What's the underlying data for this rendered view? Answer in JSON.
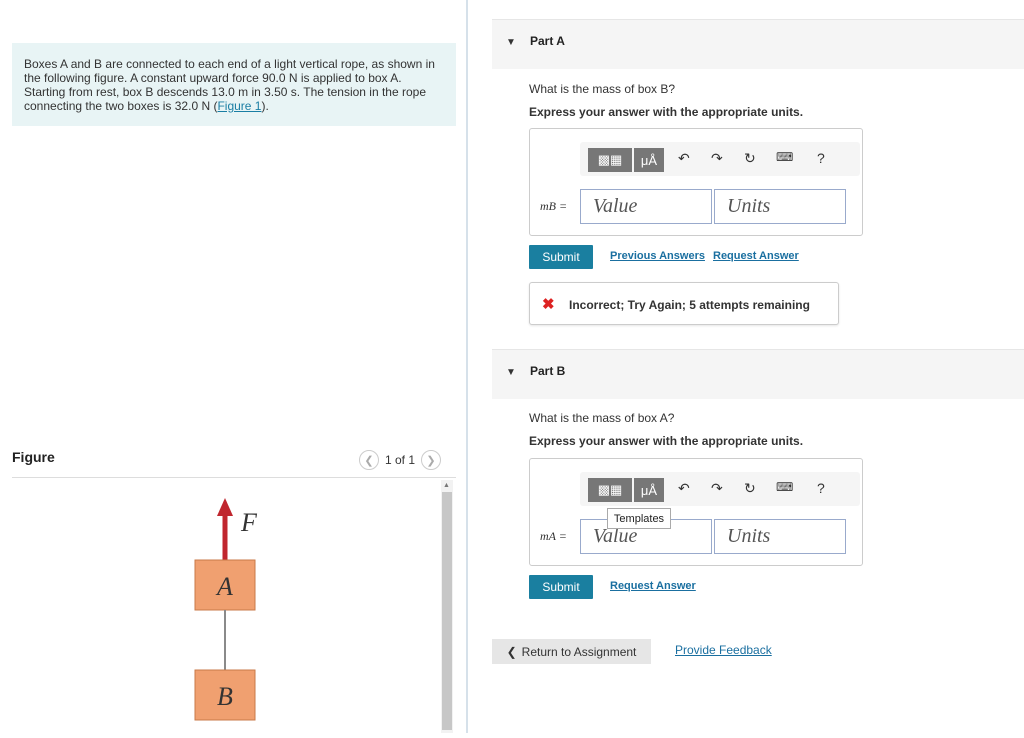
{
  "problem": {
    "line1": "Boxes A and B are connected to each end of a light vertical rope, as shown in",
    "line2": "the following figure. A constant upward force 90.0 N is applied to box A.",
    "line3": "Starting from rest, box B descends 13.0 m in 3.50 s. The tension in the rope",
    "line4_text": "connecting the two boxes is 32.0 N (",
    "figure_link": "Figure 1",
    "line4_end": ")."
  },
  "figure": {
    "title": "Figure",
    "pager_text": "1 of 1",
    "force_label": "F",
    "box_a_label": "A",
    "box_b_label": "B"
  },
  "parts": [
    {
      "label": "Part A",
      "question": "What is the mass of box B?",
      "express": "Express your answer with the appropriate units.",
      "var_label": "mB =",
      "value_placeholder": "Value",
      "units_placeholder": "Units",
      "submit_label": "Submit",
      "previous_answers": "Previous Answers",
      "request_answer": "Request Answer",
      "feedback": "Incorrect; Try Again; 5 attempts remaining"
    },
    {
      "label": "Part B",
      "question": "What is the mass of box A?",
      "express": "Express your answer with the appropriate units.",
      "var_label": "mA =",
      "value_placeholder": "Value",
      "units_placeholder": "Units",
      "submit_label": "Submit",
      "request_answer": "Request Answer",
      "tooltip": "Templates"
    }
  ],
  "toolbar": {
    "mu_label": "μÅ",
    "help": "?"
  },
  "footer": {
    "return": "Return to Assignment",
    "provide_feedback": "Provide Feedback"
  },
  "colors": {
    "accent": "#1a7fa0",
    "box_fill": "#f0a070",
    "force_arrow": "#c0262e",
    "problem_bg": "#e8f4f5"
  }
}
